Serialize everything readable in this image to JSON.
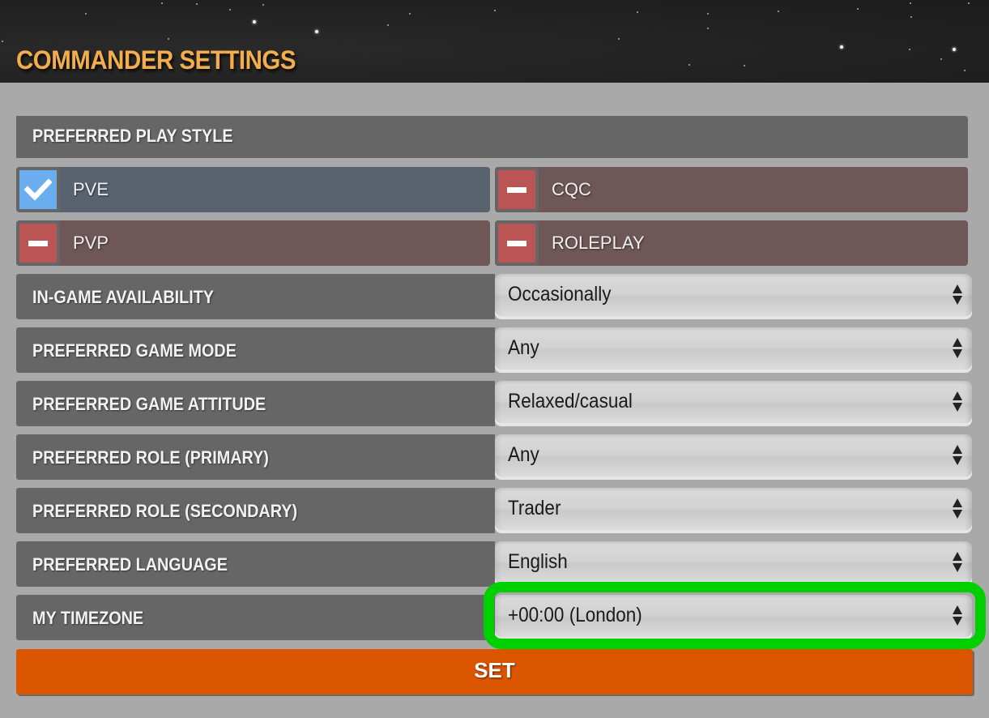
{
  "header": {
    "title": "COMMANDER SETTINGS"
  },
  "play_style": {
    "heading": "PREFERRED PLAY STYLE",
    "options": [
      {
        "label": "PVE",
        "checked": true
      },
      {
        "label": "CQC",
        "checked": false
      },
      {
        "label": "PVP",
        "checked": false
      },
      {
        "label": "ROLEPLAY",
        "checked": false
      }
    ]
  },
  "fields": [
    {
      "label": "IN-GAME AVAILABILITY",
      "value": "Occasionally"
    },
    {
      "label": "PREFERRED GAME MODE",
      "value": "Any"
    },
    {
      "label": "PREFERRED GAME ATTITUDE",
      "value": "Relaxed/casual"
    },
    {
      "label": "PREFERRED ROLE (PRIMARY)",
      "value": "Any"
    },
    {
      "label": "PREFERRED ROLE (SECONDARY)",
      "value": "Trader"
    },
    {
      "label": "PREFERRED LANGUAGE",
      "value": "English"
    },
    {
      "label": "MY TIMEZONE",
      "value": "+00:00 (London)"
    }
  ],
  "submit": {
    "label": "SET"
  },
  "colors": {
    "title": "#f4ad4c",
    "checked_box": "#6aaeef",
    "unchecked_box": "#bb5555",
    "submit": "#dc5500",
    "highlight": "#00d000"
  }
}
